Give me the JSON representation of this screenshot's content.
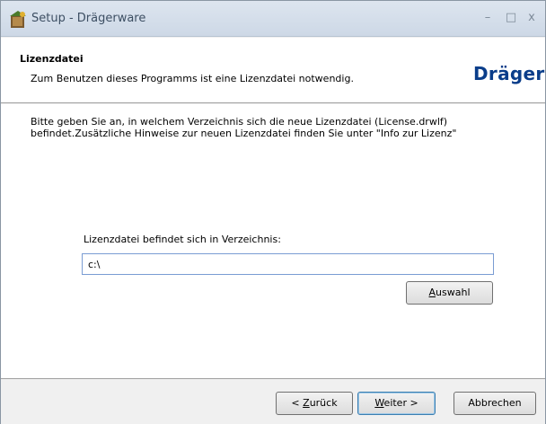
{
  "window": {
    "title": "Setup - Drägerware",
    "minimize_glyph": "–",
    "maximize_glyph": "□",
    "close_glyph": "x",
    "icon": "setup-app-icon"
  },
  "header": {
    "title": "Lizenzdatei",
    "subtitle": "Zum Benutzen dieses Programms ist eine Lizenzdatei notwendig.",
    "logo_text": "Dräger"
  },
  "body": {
    "info_line1": "Bitte geben Sie an, in welchem Verzeichnis sich die neue Lizenzdatei (License.drwlf)",
    "info_line2": "befindet.Zusätzliche Hinweise zur neuen Lizenzdatei finden Sie unter \"Info zur Lizenz\"",
    "dir_label": "Lizenzdatei befindet sich in Verzeichnis:",
    "dir_value": "c:\\",
    "browse_label_accel": "A",
    "browse_label_rest": "uswahl"
  },
  "footer": {
    "back_prefix": "< ",
    "back_accel": "Z",
    "back_rest": "urück",
    "next_accel": "W",
    "next_rest": "eiter >",
    "cancel_label": "Abbrechen"
  },
  "colors": {
    "titlebar": "#cdd8e6",
    "logo": "#0a3d8a",
    "input_border": "#7a9cd3"
  }
}
